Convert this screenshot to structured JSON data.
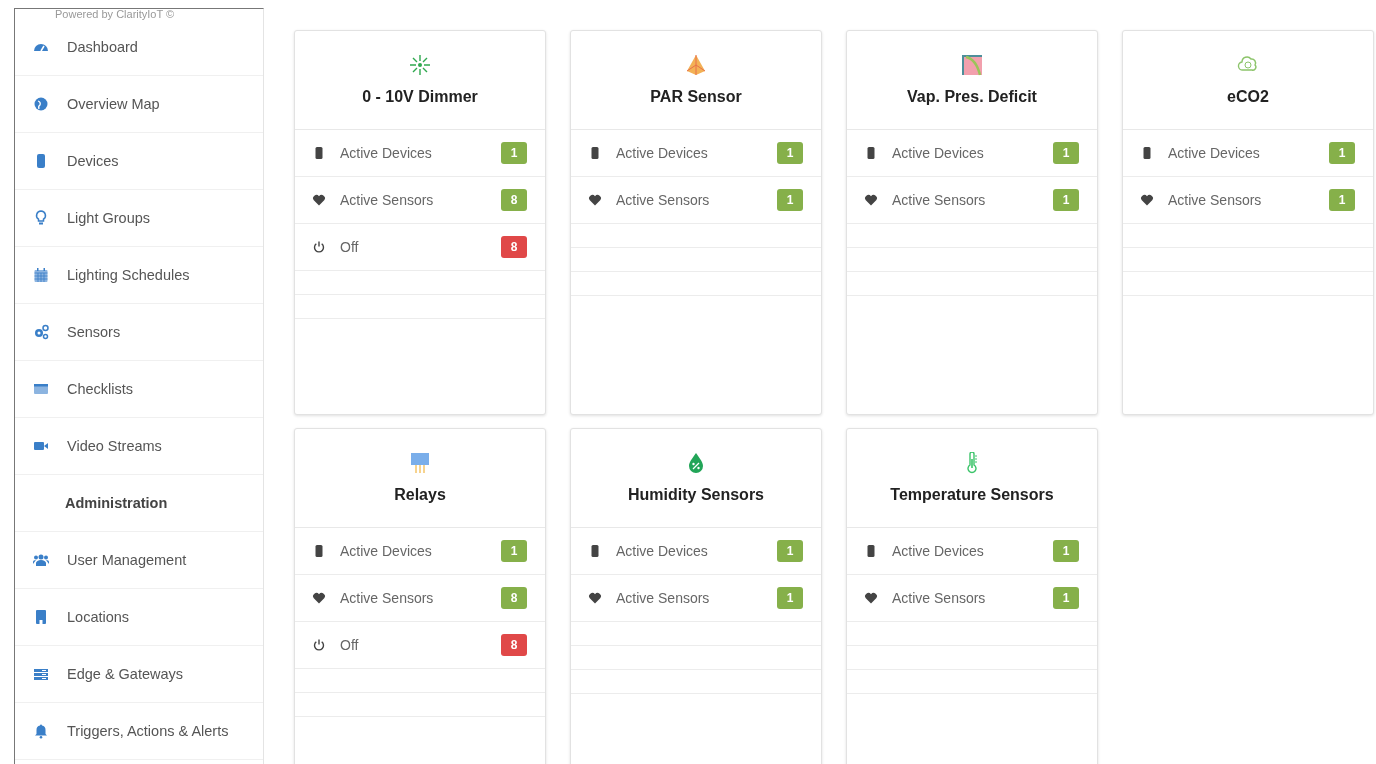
{
  "sidebar": {
    "caption": "Powered by ClarityIoT ©",
    "items": [
      {
        "kind": "dashboard",
        "label": "Dashboard"
      },
      {
        "kind": "map",
        "label": "Overview Map"
      },
      {
        "kind": "devices",
        "label": "Devices"
      },
      {
        "kind": "bulb",
        "label": "Light Groups"
      },
      {
        "kind": "calendar",
        "label": "Lighting Schedules"
      },
      {
        "kind": "cogs",
        "label": "Sensors"
      },
      {
        "kind": "window",
        "label": "Checklists"
      },
      {
        "kind": "video",
        "label": "Video Streams"
      },
      {
        "kind": "header",
        "label": "Administration"
      },
      {
        "kind": "users",
        "label": "User Management"
      },
      {
        "kind": "building",
        "label": "Locations"
      },
      {
        "kind": "server",
        "label": "Edge & Gateways"
      },
      {
        "kind": "bell",
        "label": "Triggers, Actions & Alerts"
      }
    ]
  },
  "cards": [
    {
      "kind": "dimmer",
      "title": "0 - 10V Dimmer",
      "rows": [
        {
          "kind": "devices",
          "label": "Active Devices",
          "count": "1",
          "color": "#86b04a"
        },
        {
          "kind": "sensors",
          "label": "Active Sensors",
          "count": "8",
          "color": "#86b04a"
        },
        {
          "kind": "power",
          "label": "Off",
          "count": "8",
          "color": "#e04848"
        }
      ]
    },
    {
      "kind": "par",
      "title": "PAR Sensor",
      "rows": [
        {
          "kind": "devices",
          "label": "Active Devices",
          "count": "1",
          "color": "#86b04a"
        },
        {
          "kind": "sensors",
          "label": "Active Sensors",
          "count": "1",
          "color": "#86b04a"
        }
      ]
    },
    {
      "kind": "vpd",
      "title": "Vap. Pres. Deficit",
      "rows": [
        {
          "kind": "devices",
          "label": "Active Devices",
          "count": "1",
          "color": "#86b04a"
        },
        {
          "kind": "sensors",
          "label": "Active Sensors",
          "count": "1",
          "color": "#86b04a"
        }
      ]
    },
    {
      "kind": "eco2",
      "title": "eCO2",
      "rows": [
        {
          "kind": "devices",
          "label": "Active Devices",
          "count": "1",
          "color": "#86b04a"
        },
        {
          "kind": "sensors",
          "label": "Active Sensors",
          "count": "1",
          "color": "#86b04a"
        }
      ]
    },
    {
      "kind": "relay",
      "title": "Relays",
      "rows": [
        {
          "kind": "devices",
          "label": "Active Devices",
          "count": "1",
          "color": "#86b04a"
        },
        {
          "kind": "sensors",
          "label": "Active Sensors",
          "count": "8",
          "color": "#86b04a"
        },
        {
          "kind": "power",
          "label": "Off",
          "count": "8",
          "color": "#e04848"
        }
      ]
    },
    {
      "kind": "humidity",
      "title": "Humidity Sensors",
      "rows": [
        {
          "kind": "devices",
          "label": "Active Devices",
          "count": "1",
          "color": "#86b04a"
        },
        {
          "kind": "sensors",
          "label": "Active Sensors",
          "count": "1",
          "color": "#86b04a"
        }
      ]
    },
    {
      "kind": "temperature",
      "title": "Temperature Sensors",
      "rows": [
        {
          "kind": "devices",
          "label": "Active Devices",
          "count": "1",
          "color": "#86b04a"
        },
        {
          "kind": "sensors",
          "label": "Active Sensors",
          "count": "1",
          "color": "#86b04a"
        }
      ]
    }
  ]
}
